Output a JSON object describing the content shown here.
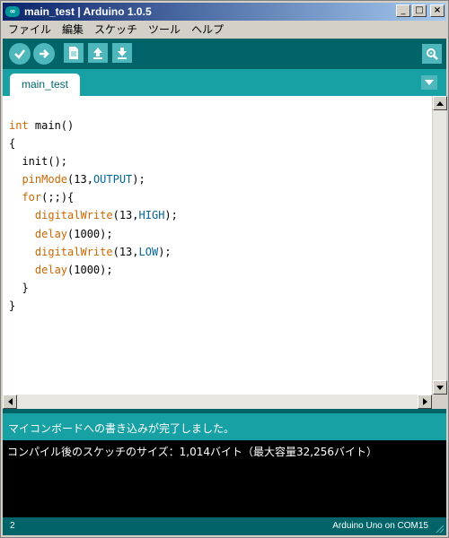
{
  "window": {
    "title": "main_test | Arduino 1.0.5",
    "icon": "arduino-icon",
    "icon_glyph": "∞",
    "min_label": "_",
    "max_label": "□",
    "close_label": "×"
  },
  "menu": [
    {
      "label": "ファイル"
    },
    {
      "label": "編集"
    },
    {
      "label": "スケッチ"
    },
    {
      "label": "ツール"
    },
    {
      "label": "ヘルプ"
    }
  ],
  "toolbar": {
    "buttons": [
      "verify-icon",
      "upload-icon",
      "new-icon",
      "open-icon",
      "save-icon"
    ],
    "serial_monitor_icon": "magnifier-icon"
  },
  "tabs": [
    {
      "label": "main_test",
      "active": true
    }
  ],
  "editor": {
    "lines": [
      [
        {
          "t": "int",
          "c": "kw"
        },
        {
          "t": " main()",
          "c": ""
        }
      ],
      [
        {
          "t": "{",
          "c": ""
        }
      ],
      [
        {
          "t": "  init();",
          "c": ""
        }
      ],
      [
        {
          "t": "  ",
          "c": ""
        },
        {
          "t": "pinMode",
          "c": "kw"
        },
        {
          "t": "(13,",
          "c": ""
        },
        {
          "t": "OUTPUT",
          "c": "const"
        },
        {
          "t": ");",
          "c": ""
        }
      ],
      [
        {
          "t": "  ",
          "c": ""
        },
        {
          "t": "for",
          "c": "kw"
        },
        {
          "t": "(;;){",
          "c": ""
        }
      ],
      [
        {
          "t": "    ",
          "c": ""
        },
        {
          "t": "digitalWrite",
          "c": "kw"
        },
        {
          "t": "(13,",
          "c": ""
        },
        {
          "t": "HIGH",
          "c": "const"
        },
        {
          "t": ");",
          "c": ""
        }
      ],
      [
        {
          "t": "    ",
          "c": ""
        },
        {
          "t": "delay",
          "c": "kw"
        },
        {
          "t": "(1000);",
          "c": ""
        }
      ],
      [
        {
          "t": "    ",
          "c": ""
        },
        {
          "t": "digitalWrite",
          "c": "kw"
        },
        {
          "t": "(13,",
          "c": ""
        },
        {
          "t": "LOW",
          "c": "const"
        },
        {
          "t": ");",
          "c": ""
        }
      ],
      [
        {
          "t": "    ",
          "c": ""
        },
        {
          "t": "delay",
          "c": "kw"
        },
        {
          "t": "(1000);",
          "c": ""
        }
      ],
      [
        {
          "t": "  }",
          "c": ""
        }
      ],
      [
        {
          "t": "}",
          "c": ""
        }
      ]
    ]
  },
  "status": {
    "message": "マイコンボードへの書き込みが完了しました。"
  },
  "console": {
    "text": "コンパイル後のスケッチのサイズ：1,014バイト（最大容量32,256バイト）"
  },
  "footer": {
    "line_number": "2",
    "board": "Arduino Uno on COM15"
  },
  "colors": {
    "teal_dark": "#006468",
    "teal": "#17a1a5",
    "button": "#4db7bb",
    "keyword": "#cc6600",
    "constant": "#006699"
  }
}
